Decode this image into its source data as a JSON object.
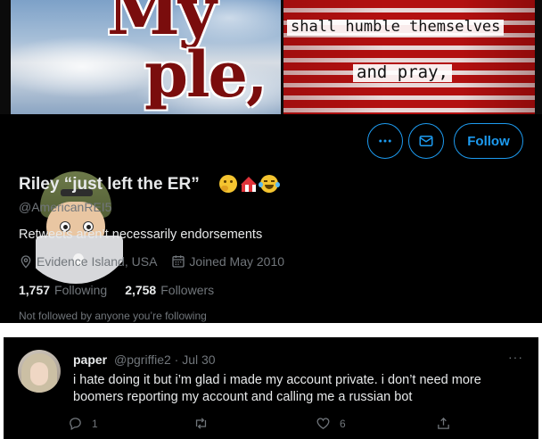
{
  "banner": {
    "left_word1": "My",
    "left_word2": "ple,",
    "right_line1": "shall humble themselves",
    "right_line2": "and pray,"
  },
  "profile": {
    "display_name": "Riley “just left the ER”",
    "name_emojis": [
      "thinking-face",
      "circus-tent",
      "face-with-tears-of-joy"
    ],
    "handle": "@AmericanREI5",
    "bio": "Retweets aren’t necessarily endorsements",
    "location": "Evidence Island, USA",
    "joined": "Joined May 2010",
    "following_count": "1,757",
    "following_label": "Following",
    "followers_count": "2,758",
    "followers_label": "Followers",
    "not_followed_text": "Not followed by anyone you’re following",
    "follow_label": "Follow",
    "more_icon": "more-icon",
    "message_icon": "message-icon"
  },
  "tweet": {
    "author_name": "paper",
    "author_handle": "@pgriffie2",
    "separator": "·",
    "date": "Jul 30",
    "more_label": "···",
    "text": "i hate doing it but i’m glad i made my account private. i don’t need more boomers reporting my account and calling me a russian bot",
    "reply_count": "1",
    "retweet_count": "",
    "like_count": "6"
  },
  "colors": {
    "accent": "#1d9bf0",
    "background": "#000000",
    "primary_text": "#e7e9ea",
    "secondary_text": "#71767b"
  }
}
